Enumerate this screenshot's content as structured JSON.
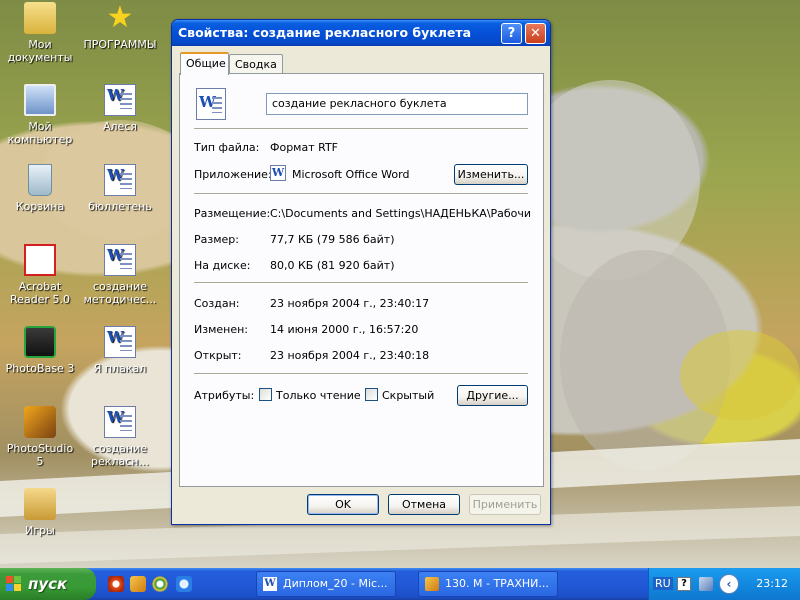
{
  "desktop": {
    "icons": [
      {
        "label": "Мои документы"
      },
      {
        "label": "ПРОГРАММЫ"
      },
      {
        "label": "Мой компьютер"
      },
      {
        "label": "Алеся"
      },
      {
        "label": "Корзина"
      },
      {
        "label": "бюллетень"
      },
      {
        "label": "Acrobat Reader 5.0"
      },
      {
        "label": "создание методичес..."
      },
      {
        "label": "PhotoBase 3"
      },
      {
        "label": "Я плакал"
      },
      {
        "label": "PhotoStudio 5"
      },
      {
        "label": "создание рекласн..."
      },
      {
        "label": "Игры"
      }
    ]
  },
  "dialog": {
    "title": "Свойства: создание рекласного буклета",
    "help_glyph": "?",
    "close_glyph": "✕",
    "tabs": [
      {
        "label": "Общие",
        "active": true
      },
      {
        "label": "Сводка",
        "active": false
      }
    ],
    "general": {
      "file_name": "создание рекласного буклета",
      "file_type_label": "Тип файла:",
      "file_type_value": "Формат RTF",
      "app_label": "Приложение:",
      "app_value": "Microsoft Office Word",
      "change_button": "Изменить...",
      "location_label": "Размещение:",
      "location_value": "C:\\Documents and Settings\\НАДЕНЬКА\\Рабочий сто",
      "size_label": "Размер:",
      "size_value": "77,7 КБ (79 586 байт)",
      "disk_label": "На диске:",
      "disk_value": "80,0 КБ (81 920 байт)",
      "created_label": "Создан:",
      "created_value": "23 ноября 2004 г., 23:40:17",
      "modified_label": "Изменен:",
      "modified_value": "14 июня 2000 г., 16:57:20",
      "opened_label": "Открыт:",
      "opened_value": "23 ноября 2004 г., 23:40:18",
      "attributes_label": "Атрибуты:",
      "readonly_label": "Только чтение",
      "readonly_checked": false,
      "hidden_label": "Скрытый",
      "hidden_checked": false,
      "other_button": "Другие..."
    },
    "buttons": {
      "ok": "OK",
      "cancel": "Отмена",
      "apply": "Применить"
    }
  },
  "taskbar": {
    "start_label": "пуск",
    "tasks": [
      {
        "label": "Диплом_20 - Mic..."
      },
      {
        "label": "130. М - ТРАХНИ..."
      }
    ],
    "tray": {
      "language": "RU",
      "clock": "23:12"
    }
  },
  "colors": {
    "title_blue": "#0550d8",
    "taskbar_blue": "#245edb",
    "start_green": "#3c9a3a",
    "dialog_bg": "#ece9d8"
  }
}
